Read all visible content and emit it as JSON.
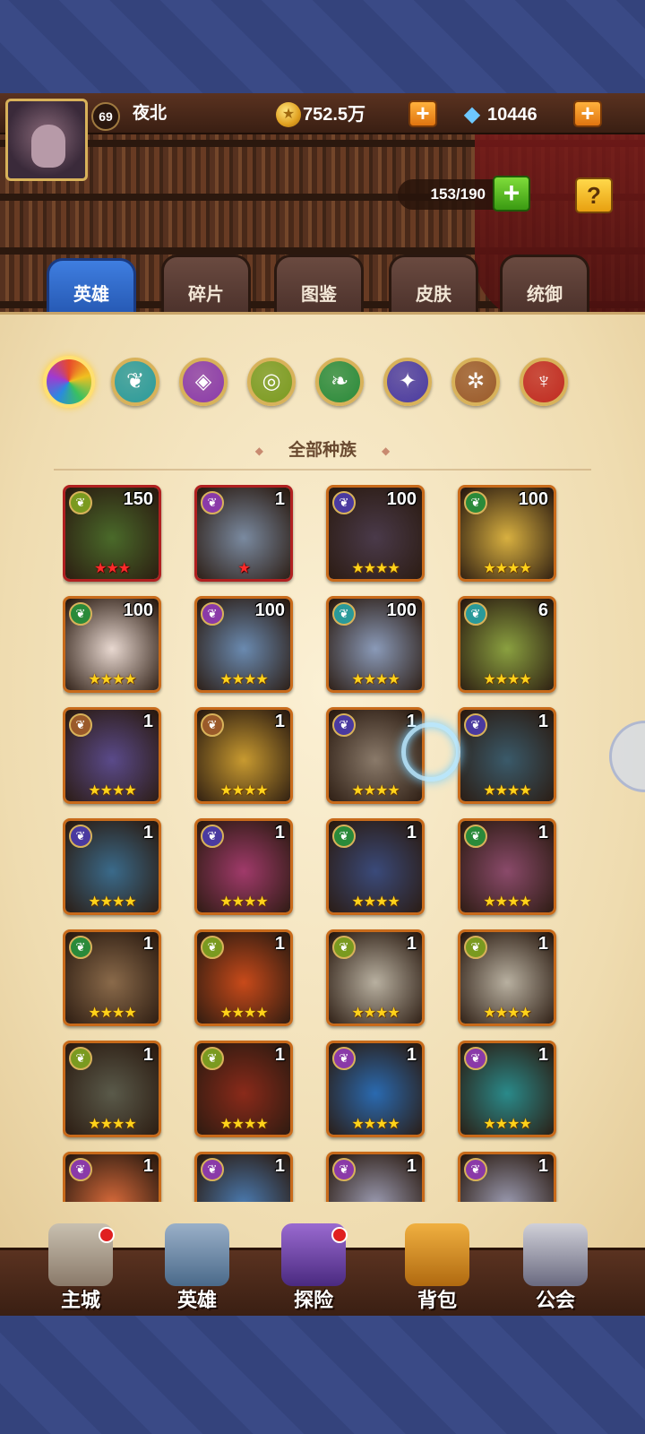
{
  "player": {
    "level": "69",
    "name": "夜北",
    "gold": "752.5万",
    "gems": "10446"
  },
  "hero_capacity": "153/190",
  "help_label": "?",
  "tabs": [
    {
      "label": "英雄",
      "active": true
    },
    {
      "label": "碎片",
      "active": false
    },
    {
      "label": "图鉴",
      "active": false
    },
    {
      "label": "皮肤",
      "active": false
    },
    {
      "label": "统御",
      "active": false
    }
  ],
  "factions": [
    {
      "icon": "all-factions-icon",
      "color": "#e84a2a",
      "active": true
    },
    {
      "icon": "forest-faction-icon",
      "color": "#2a9a9a",
      "active": false
    },
    {
      "icon": "mystic-faction-icon",
      "color": "#8a3aa8",
      "active": false
    },
    {
      "icon": "shadow-faction-icon",
      "color": "#7a9a20",
      "active": false
    },
    {
      "icon": "fortress-faction-icon",
      "color": "#2a8a3a",
      "active": false
    },
    {
      "icon": "abyss-faction-icon",
      "color": "#4a3aa0",
      "active": false
    },
    {
      "icon": "light-faction-icon",
      "color": "#9a5a2a",
      "active": false
    },
    {
      "icon": "dark-faction-icon",
      "color": "#c02a20",
      "active": false
    }
  ],
  "race_filter_label": "全部种族",
  "heroes": [
    {
      "level": "150",
      "stars": "★★★",
      "star_color": "red",
      "faction": "shadow",
      "bg": "#4a6a2a"
    },
    {
      "level": "1",
      "stars": "★",
      "star_color": "red",
      "faction": "mystic",
      "bg": "#7a8aa0"
    },
    {
      "level": "100",
      "stars": "★★★★",
      "star_color": "gold",
      "faction": "abyss",
      "bg": "#4a3a4a"
    },
    {
      "level": "100",
      "stars": "★★★★",
      "star_color": "gold",
      "faction": "fortress",
      "bg": "#d8b040"
    },
    {
      "level": "100",
      "stars": "★★★★",
      "star_color": "gold",
      "faction": "fortress",
      "bg": "#e8d8d0"
    },
    {
      "level": "100",
      "stars": "★★★★",
      "star_color": "gold",
      "faction": "mystic",
      "bg": "#6a8ab0"
    },
    {
      "level": "100",
      "stars": "★★★★",
      "star_color": "gold",
      "faction": "forest",
      "bg": "#8a9ab8"
    },
    {
      "level": "6",
      "stars": "★★★★",
      "star_color": "gold",
      "faction": "forest",
      "bg": "#8aa040"
    },
    {
      "level": "1",
      "stars": "★★★★",
      "star_color": "gold",
      "faction": "light",
      "bg": "#5a4a8a"
    },
    {
      "level": "1",
      "stars": "★★★★",
      "star_color": "gold",
      "faction": "light",
      "bg": "#c89a30"
    },
    {
      "level": "1",
      "stars": "★★★★",
      "star_color": "gold",
      "faction": "abyss",
      "bg": "#8a7a6a"
    },
    {
      "level": "1",
      "stars": "★★★★",
      "star_color": "gold",
      "faction": "abyss",
      "bg": "#3a5a6a"
    },
    {
      "level": "1",
      "stars": "★★★★",
      "star_color": "gold",
      "faction": "abyss",
      "bg": "#3a6a8a"
    },
    {
      "level": "1",
      "stars": "★★★★",
      "star_color": "gold",
      "faction": "abyss",
      "bg": "#a03a6a"
    },
    {
      "level": "1",
      "stars": "★★★★",
      "star_color": "gold",
      "faction": "fortress",
      "bg": "#3a4a7a"
    },
    {
      "level": "1",
      "stars": "★★★★",
      "star_color": "gold",
      "faction": "fortress",
      "bg": "#8a4a6a"
    },
    {
      "level": "1",
      "stars": "★★★★",
      "star_color": "gold",
      "faction": "fortress",
      "bg": "#8a6a4a"
    },
    {
      "level": "1",
      "stars": "★★★★",
      "star_color": "gold",
      "faction": "shadow",
      "bg": "#c84a1a"
    },
    {
      "level": "1",
      "stars": "★★★★",
      "star_color": "gold",
      "faction": "shadow",
      "bg": "#b8b0a0"
    },
    {
      "level": "1",
      "stars": "★★★★",
      "star_color": "gold",
      "faction": "shadow",
      "bg": "#b8b0a0"
    },
    {
      "level": "1",
      "stars": "★★★★",
      "star_color": "gold",
      "faction": "shadow",
      "bg": "#5a5a4a"
    },
    {
      "level": "1",
      "stars": "★★★★",
      "star_color": "gold",
      "faction": "shadow",
      "bg": "#8a2a1a"
    },
    {
      "level": "1",
      "stars": "★★★★",
      "star_color": "gold",
      "faction": "mystic",
      "bg": "#2a6ab0"
    },
    {
      "level": "1",
      "stars": "★★★★",
      "star_color": "gold",
      "faction": "mystic",
      "bg": "#2a8a8a"
    },
    {
      "level": "1",
      "stars": "",
      "star_color": "gold",
      "faction": "mystic",
      "bg": "#d86a3a"
    },
    {
      "level": "1",
      "stars": "",
      "star_color": "gold",
      "faction": "mystic",
      "bg": "#4a7ab0"
    },
    {
      "level": "1",
      "stars": "",
      "star_color": "gold",
      "faction": "mystic",
      "bg": "#9a9ab0"
    },
    {
      "level": "1",
      "stars": "",
      "star_color": "gold",
      "faction": "mystic",
      "bg": "#9a9ab0"
    }
  ],
  "bottom_nav": [
    {
      "label": "主城",
      "icon": "castle-icon",
      "badge": true
    },
    {
      "label": "英雄",
      "icon": "hero-icon",
      "badge": false
    },
    {
      "label": "探险",
      "icon": "portal-icon",
      "badge": true
    },
    {
      "label": "背包",
      "icon": "backpack-icon",
      "badge": false
    },
    {
      "label": "公会",
      "icon": "guild-tower-icon",
      "badge": false
    }
  ],
  "faction_colors": {
    "shadow": "#7a9a20",
    "mystic": "#8a3aa8",
    "abyss": "#4a3aa0",
    "fortress": "#2a8a3a",
    "forest": "#2a9a9a",
    "light": "#9a5a2a"
  }
}
